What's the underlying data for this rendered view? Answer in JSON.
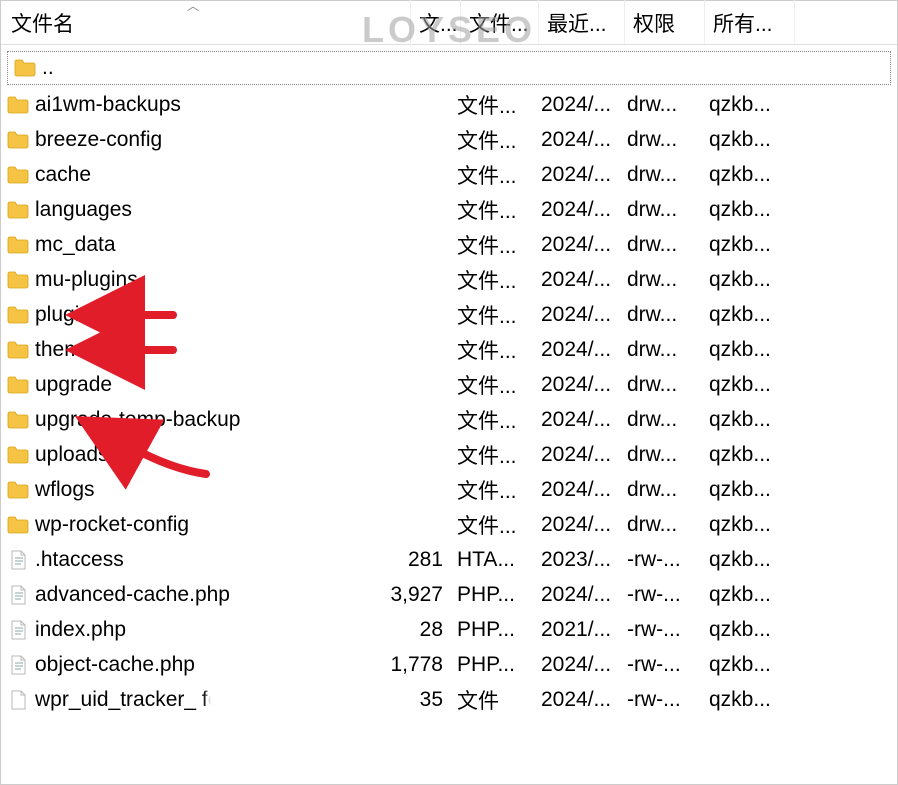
{
  "watermark_text": "LOYSEO",
  "columns": {
    "name": "文件名",
    "size": "文...",
    "type": "文件...",
    "date": "最近...",
    "perm": "权限",
    "owner": "所有..."
  },
  "parent_row": {
    "name": ".."
  },
  "rows": [
    {
      "icon": "folder",
      "name": "ai1wm-backups",
      "size": "",
      "type": "文件...",
      "date": "2024/...",
      "perm": "drw...",
      "owner": "qzkb...",
      "arrow": false
    },
    {
      "icon": "folder",
      "name": "breeze-config",
      "size": "",
      "type": "文件...",
      "date": "2024/...",
      "perm": "drw...",
      "owner": "qzkb...",
      "arrow": false
    },
    {
      "icon": "folder",
      "name": "cache",
      "size": "",
      "type": "文件...",
      "date": "2024/...",
      "perm": "drw...",
      "owner": "qzkb...",
      "arrow": false
    },
    {
      "icon": "folder",
      "name": "languages",
      "size": "",
      "type": "文件...",
      "date": "2024/...",
      "perm": "drw...",
      "owner": "qzkb...",
      "arrow": false
    },
    {
      "icon": "folder",
      "name": "mc_data",
      "size": "",
      "type": "文件...",
      "date": "2024/...",
      "perm": "drw...",
      "owner": "qzkb...",
      "arrow": false
    },
    {
      "icon": "folder",
      "name": "mu-plugins",
      "size": "",
      "type": "文件...",
      "date": "2024/...",
      "perm": "drw...",
      "owner": "qzkb...",
      "arrow": false
    },
    {
      "icon": "folder",
      "name": "plugins",
      "size": "",
      "type": "文件...",
      "date": "2024/...",
      "perm": "drw...",
      "owner": "qzkb...",
      "arrow": true,
      "arrow_style": "short"
    },
    {
      "icon": "folder",
      "name": "themes",
      "size": "",
      "type": "文件...",
      "date": "2024/...",
      "perm": "drw...",
      "owner": "qzkb...",
      "arrow": true,
      "arrow_style": "short"
    },
    {
      "icon": "folder",
      "name": "upgrade",
      "size": "",
      "type": "文件...",
      "date": "2024/...",
      "perm": "drw...",
      "owner": "qzkb...",
      "arrow": false
    },
    {
      "icon": "folder",
      "name": "upgrade-temp-backup",
      "size": "",
      "type": "文件...",
      "date": "2024/...",
      "perm": "drw...",
      "owner": "qzkb...",
      "arrow": false
    },
    {
      "icon": "folder",
      "name": "uploads",
      "size": "",
      "type": "文件...",
      "date": "2024/...",
      "perm": "drw...",
      "owner": "qzkb...",
      "arrow": true,
      "arrow_style": "long"
    },
    {
      "icon": "folder",
      "name": "wflogs",
      "size": "",
      "type": "文件...",
      "date": "2024/...",
      "perm": "drw...",
      "owner": "qzkb...",
      "arrow": false
    },
    {
      "icon": "folder",
      "name": "wp-rocket-config",
      "size": "",
      "type": "文件...",
      "date": "2024/...",
      "perm": "drw...",
      "owner": "qzkb...",
      "arrow": false
    },
    {
      "icon": "file-text",
      "name": ".htaccess",
      "size": "281",
      "type": "HTA...",
      "date": "2023/...",
      "perm": "-rw-...",
      "owner": "qzkb...",
      "arrow": false
    },
    {
      "icon": "file-php",
      "name": "advanced-cache.php",
      "size": "3,927",
      "type": "PHP...",
      "date": "2024/...",
      "perm": "-rw-...",
      "owner": "qzkb...",
      "arrow": false
    },
    {
      "icon": "file-php",
      "name": "index.php",
      "size": "28",
      "type": "PHP...",
      "date": "2021/...",
      "perm": "-rw-...",
      "owner": "qzkb...",
      "arrow": false
    },
    {
      "icon": "file-php",
      "name": "object-cache.php",
      "size": "1,778",
      "type": "PHP...",
      "date": "2024/...",
      "perm": "-rw-...",
      "owner": "qzkb...",
      "arrow": false
    },
    {
      "icon": "file",
      "name": "wpr_uid_tracker_          fe...",
      "size": "35",
      "type": "文件",
      "date": "2024/...",
      "perm": "-rw-...",
      "owner": "qzkb...",
      "arrow": false,
      "blurred": true
    }
  ],
  "icons": {
    "folder_fill": "#F6C445",
    "folder_stroke": "#D9A316",
    "file_fill": "#FFFFFF",
    "file_stroke": "#B8B8B8",
    "arrow_color": "#E11D2A"
  }
}
